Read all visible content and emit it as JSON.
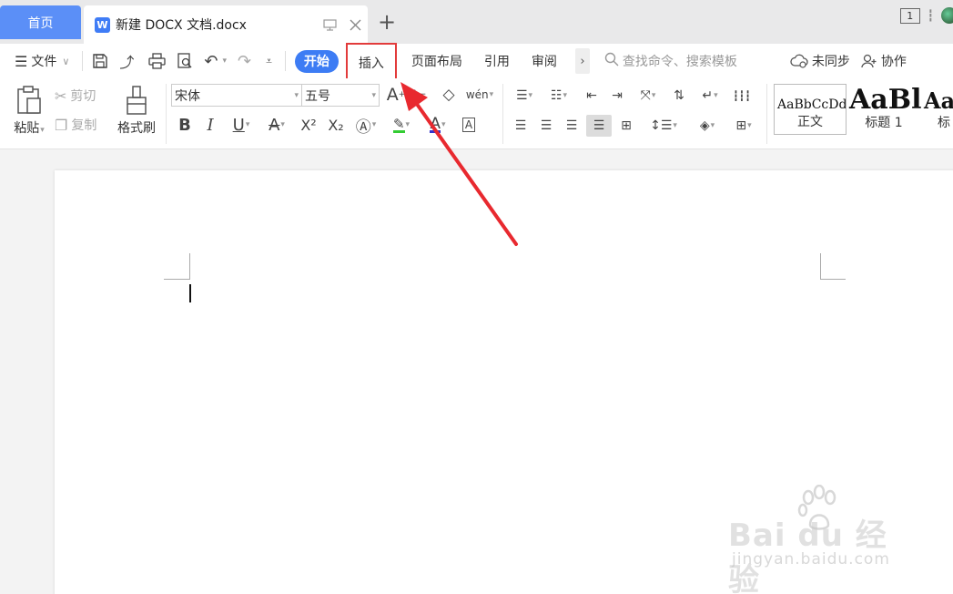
{
  "tabs": {
    "home": "首页",
    "document": "新建 DOCX 文档.docx",
    "new_tab": "+"
  },
  "topright": {
    "page_count": "1"
  },
  "menubar": {
    "file": "文件",
    "start": "开始",
    "insert": "插入",
    "page_layout": "页面布局",
    "references": "引用",
    "review": "审阅",
    "more": "›",
    "search_placeholder": "查找命令、搜索模板",
    "sync": "未同步",
    "collaborate": "协作"
  },
  "ribbon": {
    "paste": "粘贴",
    "cut": "剪切",
    "copy": "复制",
    "format_painter": "格式刷",
    "font_name": "宋体",
    "font_size": "五号",
    "pinyin_glyph": "wén",
    "superscript_glyph": "X²",
    "subscript_glyph": "X₂",
    "styles": [
      {
        "preview": "AaBbCcDd",
        "name": "正文"
      },
      {
        "preview": "AaBl",
        "name": "标题 1"
      },
      {
        "preview": "Aa",
        "name": "标"
      }
    ]
  },
  "watermark": {
    "brand": "Bai  du 经验",
    "site": "jingyan.baidu.com"
  },
  "colors": {
    "accent": "#3d7cf4",
    "home_tab": "#5b8ff7",
    "highlight_box": "#e23b3b",
    "highlight_green": "#33cc33",
    "font_color_blue": "#3333cc"
  }
}
